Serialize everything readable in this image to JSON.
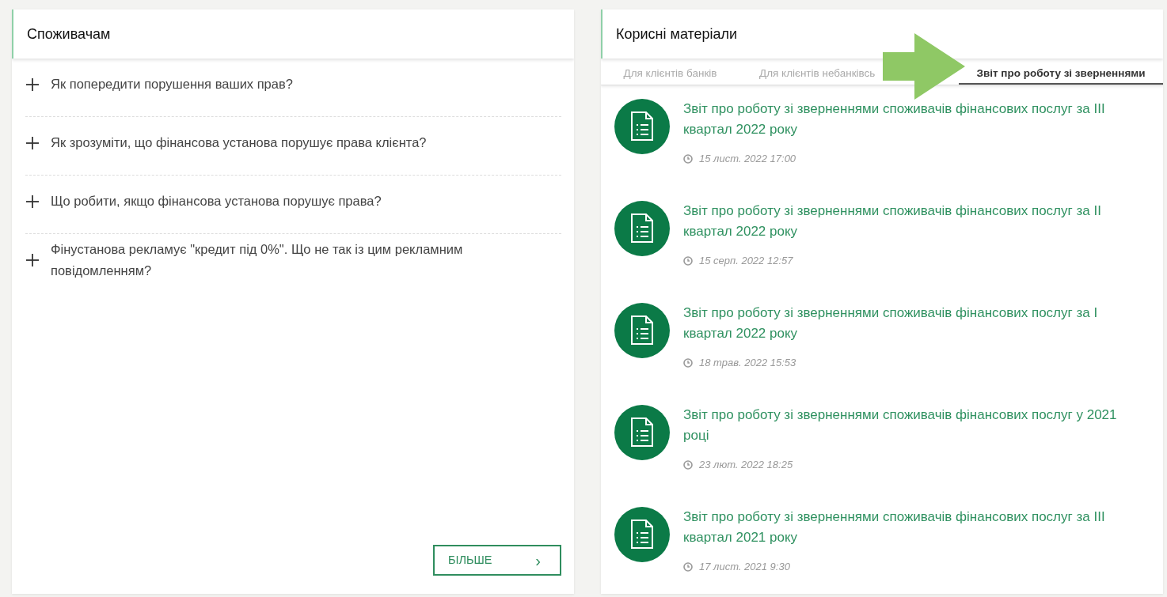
{
  "consumers": {
    "title": "Споживачам",
    "questions": [
      {
        "text": "Як попередити порушення ваших прав?",
        "expanded": false
      },
      {
        "text": "Як зрозуміти, що фінансова установа порушує права клієнта?",
        "expanded": false
      },
      {
        "text": "Що робити, якщо фінансова установа порушує права?",
        "expanded": false
      },
      {
        "text": "Фінустанова рекламує \"кредит під 0%\". Що не так із цим рекламним повідомленням?",
        "expanded": false
      }
    ],
    "more_button": {
      "label": "БІЛЬШЕ",
      "chevron": "›"
    }
  },
  "materials": {
    "title": "Корисні матеріали",
    "tabs": [
      {
        "label": "Для клієнтів банків",
        "selected": false
      },
      {
        "label": "Для клієнтів небанківсь",
        "selected": false
      },
      {
        "label": "Звіт про роботу зі зверненнями",
        "selected": true
      }
    ],
    "items": [
      {
        "title": "Звіт про роботу зі зверненнями споживачів фінансових послуг за III квартал 2022 року",
        "date": "15 лист. 2022 17:00"
      },
      {
        "title": "Звіт про роботу зі зверненнями споживачів фінансових послуг за II квартал 2022 року",
        "date": "15 серп. 2022 12:57"
      },
      {
        "title": "Звіт про роботу зі зверненнями споживачів фінансових послуг за I квартал 2022 року",
        "date": "18 трав. 2022 15:53"
      },
      {
        "title": "Звіт про роботу зі зверненнями споживачів фінансових послуг у 2021 році",
        "date": "23 лют. 2022 18:25"
      },
      {
        "title": "Звіт про роботу зі зверненнями споживачів фінансових послуг за III квартал 2021 року",
        "date": "17 лист. 2021 9:30"
      }
    ]
  }
}
